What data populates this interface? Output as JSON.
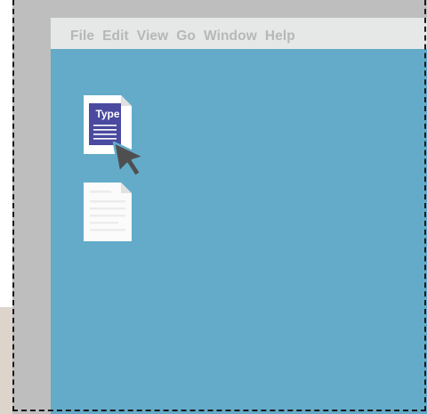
{
  "menubar": {
    "items": [
      {
        "label": "File"
      },
      {
        "label": "Edit"
      },
      {
        "label": "View"
      },
      {
        "label": "Go"
      },
      {
        "label": "Window"
      },
      {
        "label": "Help"
      }
    ]
  },
  "desktop": {
    "icons": [
      {
        "name": "type-document",
        "label": "Type",
        "icon": "document-icon"
      },
      {
        "name": "blank-document",
        "icon": "document-icon"
      }
    ]
  },
  "colors": {
    "desktop": "#63abc9",
    "menubar": "#e6e8e8",
    "menu_text": "#b7b7b7",
    "bezel": "#bebebe",
    "document_accent": "#4a4aa0",
    "cursor": "#4f4f4f"
  }
}
